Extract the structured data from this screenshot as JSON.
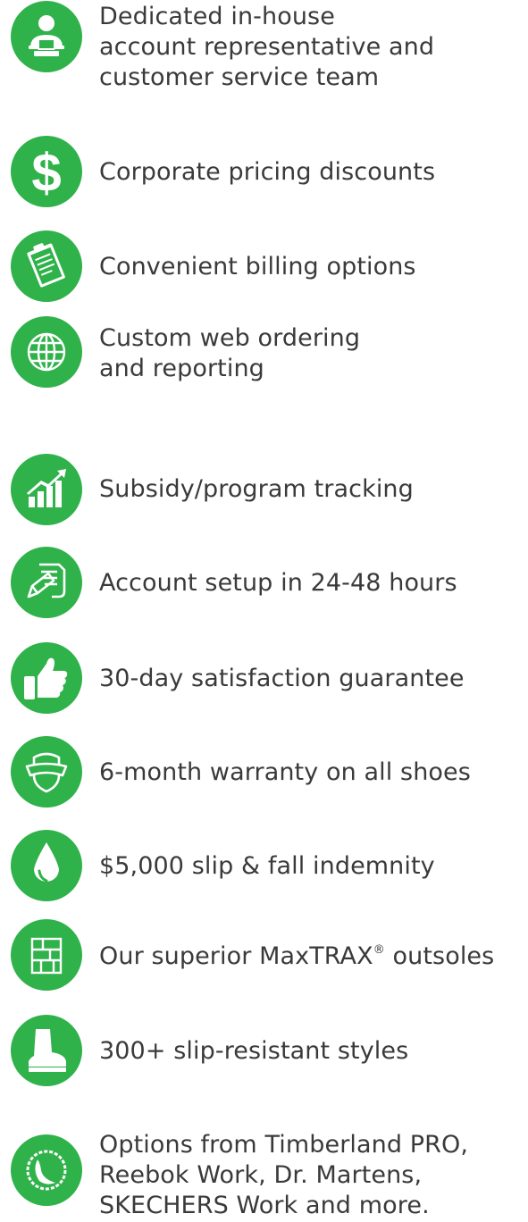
{
  "colors": {
    "accent": "#2fb24a",
    "icon_fg": "#ffffff",
    "text": "#3a3a3a"
  },
  "features": [
    {
      "icon": "customer-service-rep-icon",
      "lines": [
        "Dedicated in-house",
        "account representative and",
        "customer service team"
      ]
    },
    {
      "icon": "dollar-sign-icon",
      "lines": [
        "Corporate pricing discounts"
      ]
    },
    {
      "icon": "clipboard-invoice-icon",
      "lines": [
        "Convenient billing options"
      ]
    },
    {
      "icon": "globe-icon",
      "lines": [
        "Custom web ordering",
        "and reporting"
      ]
    },
    {
      "icon": "growth-chart-icon",
      "lines": [
        "Subsidy/program tracking"
      ]
    },
    {
      "icon": "document-pencil-icon",
      "lines": [
        "Account setup in 24-48 hours"
      ]
    },
    {
      "icon": "thumbs-up-icon",
      "lines": [
        "30-day satisfaction guarantee"
      ]
    },
    {
      "icon": "shield-banner-icon",
      "lines": [
        "6-month warranty on all shoes"
      ]
    },
    {
      "icon": "water-drop-icon",
      "lines": [
        "$5,000 slip & fall indemnity"
      ]
    },
    {
      "icon": "outsole-tread-icon",
      "lines": [
        "Our superior MaxTRAX",
        "®",
        " outsoles"
      ]
    },
    {
      "icon": "work-boot-icon",
      "lines": [
        "300+ slip-resistant styles"
      ]
    },
    {
      "icon": "seal-badge-icon",
      "lines": [
        "Options from Timberland PRO,",
        "Reebok Work, Dr. Martens,",
        "SKECHERS Work and more."
      ]
    }
  ]
}
